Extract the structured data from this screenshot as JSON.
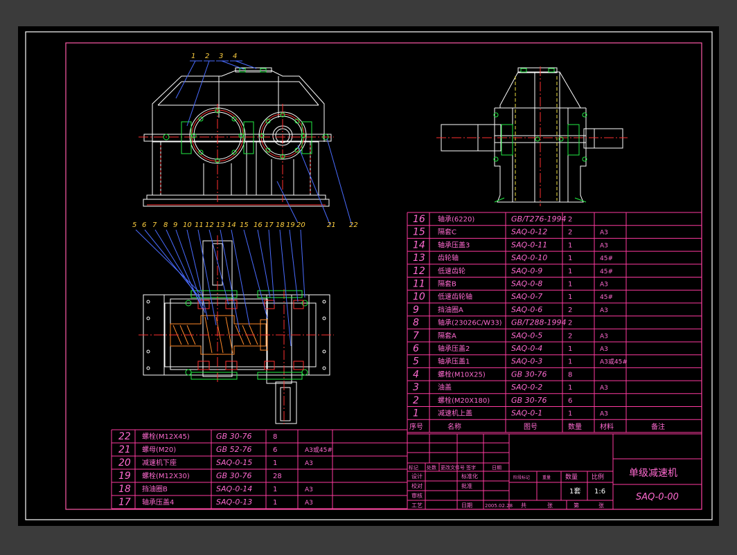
{
  "colors": {
    "background": "#000000",
    "outer_bg": "#3b3b3b",
    "frame": "#ffffff",
    "border": "#ff5aa8",
    "table_lines": "#ff3aa0",
    "table_text": "#ff6ad0",
    "centerline": "#ff3030",
    "leader_blue": "#4a6cff",
    "bolt_green": "#22ee44",
    "hatch_orange": "#ff8a2a",
    "hidden_yellow": "#f0e040",
    "title_text": "#ff6ad0"
  },
  "leaders_top": [
    "1",
    "2",
    "3",
    "4",
    "21",
    "22"
  ],
  "leaders_plan": [
    "5",
    "6",
    "7",
    "8",
    "9",
    "10",
    "11",
    "12",
    "13",
    "14",
    "15",
    "16",
    "17",
    "18",
    "19",
    "20"
  ],
  "parts_list_right": [
    {
      "no": "16",
      "name": "轴承(6220)",
      "code": "GB/T276-1994",
      "qty": "2",
      "material": "",
      "remark": ""
    },
    {
      "no": "15",
      "name": "隔套C",
      "code": "SAQ-0-12",
      "qty": "2",
      "material": "A3",
      "remark": ""
    },
    {
      "no": "14",
      "name": "轴承压盖3",
      "code": "SAQ-0-11",
      "qty": "1",
      "material": "A3",
      "remark": ""
    },
    {
      "no": "13",
      "name": "齿轮轴",
      "code": "SAQ-0-10",
      "qty": "1",
      "material": "45#",
      "remark": ""
    },
    {
      "no": "12",
      "name": "低速齿轮",
      "code": "SAQ-0-9",
      "qty": "1",
      "material": "45#",
      "remark": ""
    },
    {
      "no": "11",
      "name": "隔套B",
      "code": "SAQ-0-8",
      "qty": "1",
      "material": "A3",
      "remark": ""
    },
    {
      "no": "10",
      "name": "低速齿轮轴",
      "code": "SAQ-0-7",
      "qty": "1",
      "material": "45#",
      "remark": ""
    },
    {
      "no": "9",
      "name": "挡油圈A",
      "code": "SAQ-0-6",
      "qty": "2",
      "material": "A3",
      "remark": ""
    },
    {
      "no": "8",
      "name": "轴承(23026C/W33)",
      "code": "GB/T288-1994",
      "qty": "2",
      "material": "",
      "remark": ""
    },
    {
      "no": "7",
      "name": "隔套A",
      "code": "SAQ-0-5",
      "qty": "2",
      "material": "A3",
      "remark": ""
    },
    {
      "no": "6",
      "name": "轴承压盖2",
      "code": "SAQ-0-4",
      "qty": "1",
      "material": "A3",
      "remark": ""
    },
    {
      "no": "5",
      "name": "轴承压盖1",
      "code": "SAQ-0-3",
      "qty": "1",
      "material": "A3或45#",
      "remark": ""
    },
    {
      "no": "4",
      "name": "螺栓(M10X25)",
      "code": "GB 30-76",
      "qty": "8",
      "material": "",
      "remark": ""
    },
    {
      "no": "3",
      "name": "油盖",
      "code": "SAQ-0-2",
      "qty": "1",
      "material": "A3",
      "remark": ""
    },
    {
      "no": "2",
      "name": "螺栓(M20X180)",
      "code": "GB 30-76",
      "qty": "6",
      "material": "",
      "remark": ""
    },
    {
      "no": "1",
      "name": "减速机上盖",
      "code": "SAQ-0-1",
      "qty": "1",
      "material": "A3",
      "remark": ""
    }
  ],
  "parts_header": {
    "no": "序号",
    "name": "名称",
    "code": "图号",
    "qty": "数量",
    "material": "材料",
    "remark": "备注"
  },
  "parts_list_left": [
    {
      "no": "22",
      "name": "螺栓(M12X45)",
      "code": "GB 30-76",
      "qty": "8",
      "material": ""
    },
    {
      "no": "21",
      "name": "螺母(M20)",
      "code": "GB 52-76",
      "qty": "6",
      "material": "A3或45#"
    },
    {
      "no": "20",
      "name": "减速机下座",
      "code": "SAQ-0-15",
      "qty": "1",
      "material": "A3"
    },
    {
      "no": "19",
      "name": "螺栓(M12X30)",
      "code": "GB 30-76",
      "qty": "28",
      "material": ""
    },
    {
      "no": "18",
      "name": "挡油圈B",
      "code": "SAQ-0-14",
      "qty": "1",
      "material": "A3"
    },
    {
      "no": "17",
      "name": "轴承压盖4",
      "code": "SAQ-0-13",
      "qty": "1",
      "material": "A3"
    }
  ],
  "title_block": {
    "title": "单级减速机",
    "drawing_no": "SAQ-0-00",
    "revision_header": [
      "标记",
      "处数",
      "更改文件号",
      "签字",
      "日期"
    ],
    "design": "设计",
    "check": "校对",
    "review": "审核",
    "process": "工艺",
    "standardization": "标准化",
    "approval": "批准",
    "date_label": "日期",
    "date_value": "2005.02.28",
    "stage_label": "阶段标记",
    "weight_label": "重量",
    "qty_label": "数量",
    "scale_label": "比例",
    "qty_value": "1套",
    "scale_value": "1:6",
    "sheets_total": "共",
    "sheets_label": "张",
    "sheet_of": "第",
    "sheet_label": "张"
  }
}
